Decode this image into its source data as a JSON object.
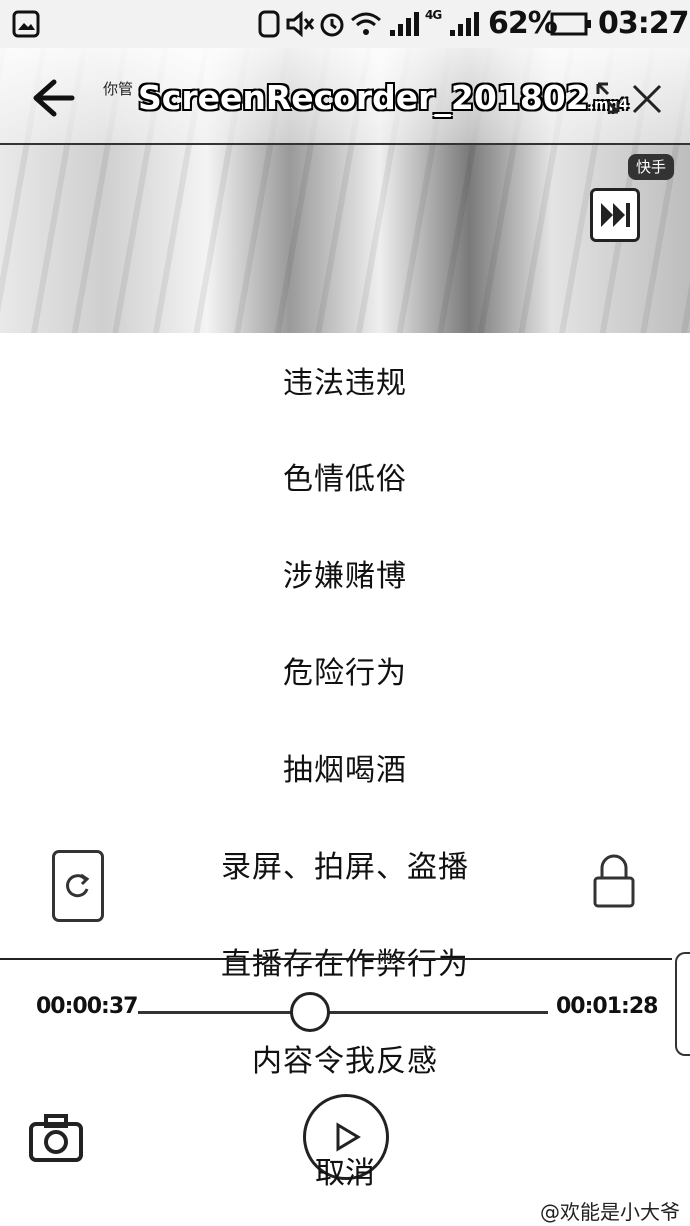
{
  "status_bar": {
    "battery_percent": "62%",
    "time": "03:27",
    "network": "4G"
  },
  "video": {
    "title": "ScreenRecorder_201802",
    "title_ext": ".mp4",
    "subtitle": "你管",
    "badge": "快手"
  },
  "report_menu": {
    "items": [
      "违法违规",
      "色情低俗",
      "涉嫌赌博",
      "危险行为",
      "抽烟喝酒",
      "录屏、拍屏、盗播",
      "直播存在作弊行为",
      "内容令我反感"
    ],
    "cancel": "取消"
  },
  "player": {
    "current_time": "00:00:37",
    "total_time": "00:01:28",
    "progress_fraction": 0.42
  },
  "watermark": "@欢能是小大爷"
}
